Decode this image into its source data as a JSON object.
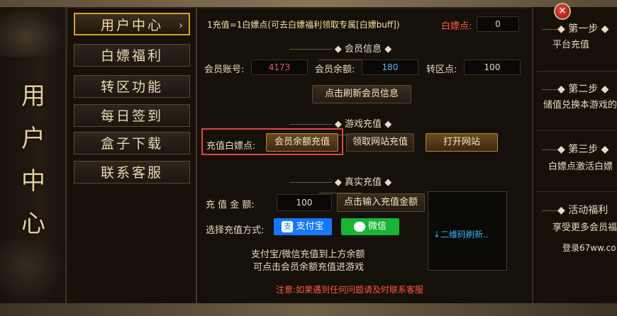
{
  "sidebar_title": [
    "用",
    "户",
    "中",
    "心"
  ],
  "nav": {
    "items": [
      {
        "label": "用户中心",
        "chevron": "›",
        "active": true
      },
      {
        "label": "白嫖福利"
      },
      {
        "label": "转区功能"
      },
      {
        "label": "每日签到"
      },
      {
        "label": "盒子下载"
      },
      {
        "label": "联系客服"
      }
    ]
  },
  "main": {
    "notice": "1充值=1白嫖点(可去白嫖福利领取专属[白嫖buff])",
    "points_label": "白嫖点:",
    "points_value": "0",
    "member": {
      "heading": "会员信息",
      "account_label": "会员账号:",
      "account_value": "4173",
      "balance_label": "会员余额:",
      "balance_value": "180",
      "transfer_label": "转区点:",
      "transfer_value": "100",
      "refresh_button": "点击刷新会员信息"
    },
    "game_recharge": {
      "heading": "游戏充值",
      "label": "充值白嫖点:",
      "balance_button": "会员余额充值",
      "site_button": "领取网站充值",
      "open_site_button": "打开网站"
    },
    "real_recharge": {
      "heading": "真实充值",
      "amount_label": "充 值 金 额:",
      "amount_value": "100",
      "input_button": "点击输入充值金额",
      "method_label": "选择充值方式:",
      "alipay": "支付宝",
      "wechat": "微信",
      "qr_text": "↓二维码刷新..",
      "tip1": "支付宝/微信充值到上方余额",
      "tip2": "可点击会员余额充值进游戏",
      "warning": "注意:如果遇到任何问题请及时联系客服"
    }
  },
  "steps": {
    "close": "×",
    "items": [
      {
        "title": "第一步",
        "desc": "平台充值"
      },
      {
        "title": "第二步",
        "desc": "储值兑换本游戏的"
      },
      {
        "title": "第三步",
        "desc": "白嫖点激活白嫖"
      },
      {
        "title": "活动福利",
        "desc": "享受更多会员福"
      }
    ],
    "link": "登录67ww.co"
  },
  "colors": {
    "accent_gold": "#d2a12a",
    "highlight_red": "#e0473f",
    "alipay_blue": "#1677ff",
    "wechat_green": "#19b336"
  }
}
